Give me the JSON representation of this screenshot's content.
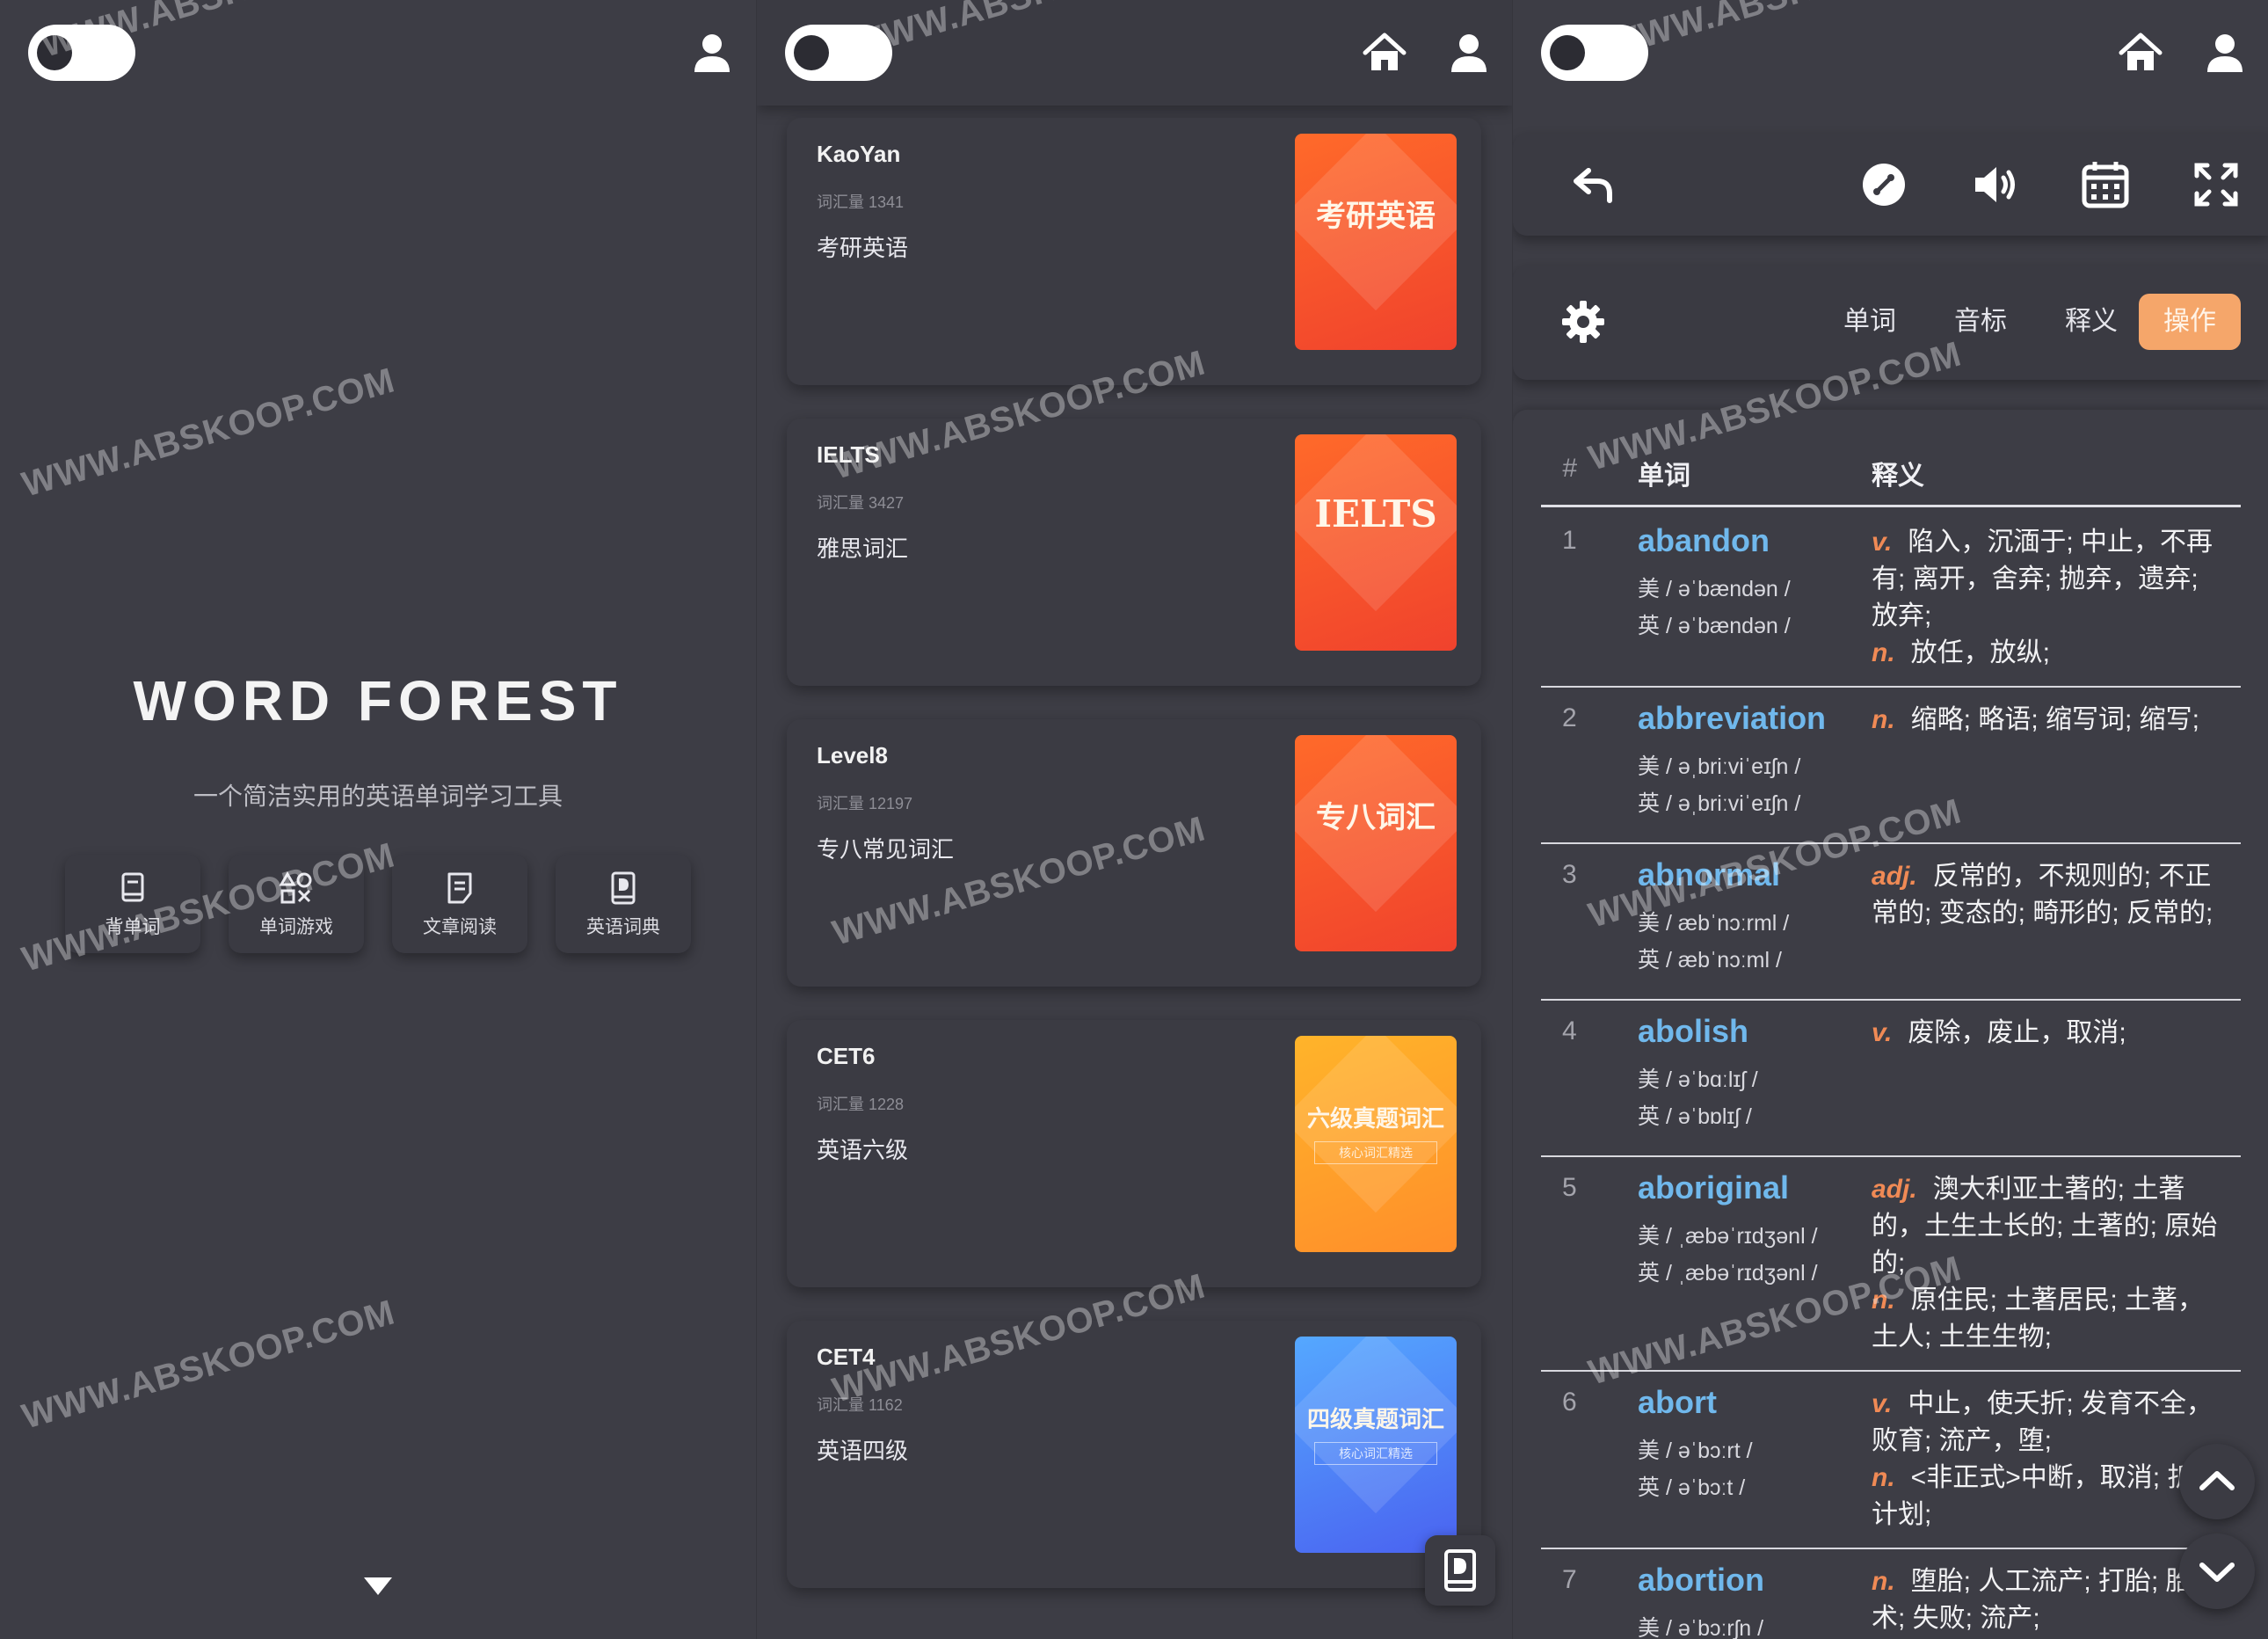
{
  "panel1": {
    "title": "WORD FOREST",
    "subtitle": "一个简洁实用的英语单词学习工具",
    "nav": [
      {
        "label": "背单词"
      },
      {
        "label": "单词游戏"
      },
      {
        "label": "文章阅读"
      },
      {
        "label": "英语词典"
      }
    ]
  },
  "panel2": {
    "books": [
      {
        "name": "KaoYan",
        "count": "词汇量 1341",
        "desc": "考研英语",
        "cover_title": "考研英语",
        "cover_sub": "",
        "cover_colors": [
          "#ff6a2a",
          "#f0422d"
        ]
      },
      {
        "name": "IELTS",
        "count": "词汇量 3427",
        "desc": "雅思词汇",
        "cover_title": "IELTS",
        "cover_sub": "",
        "cover_colors": [
          "#ff6a2a",
          "#f0422d"
        ]
      },
      {
        "name": "Level8",
        "count": "词汇量 12197",
        "desc": "专八常见词汇",
        "cover_title": "专八词汇",
        "cover_sub": "",
        "cover_colors": [
          "#ff6a2a",
          "#f0422d"
        ]
      },
      {
        "name": "CET6",
        "count": "词汇量 1228",
        "desc": "英语六级",
        "cover_title": "六级真题词汇",
        "cover_sub": "核心词汇精选",
        "cover_colors": [
          "#ffb42a",
          "#ff8e2a"
        ]
      },
      {
        "name": "CET4",
        "count": "词汇量 1162",
        "desc": "英语四级",
        "cover_title": "四级真题词汇",
        "cover_sub": "核心词汇精选",
        "cover_colors": [
          "#55a8ff",
          "#4a62f0"
        ]
      }
    ]
  },
  "panel3": {
    "tabs": [
      {
        "label": "单词",
        "active": false
      },
      {
        "label": "音标",
        "active": false
      },
      {
        "label": "释义",
        "active": false
      },
      {
        "label": "操作",
        "active": true
      }
    ],
    "table": {
      "headers": {
        "num": "#",
        "word": "单词",
        "def": "释义"
      },
      "rows": [
        {
          "num": "1",
          "word": "abandon",
          "us": "美 / əˈbændən /",
          "uk": "英 / əˈbændən /",
          "defs": [
            {
              "pos": "v.",
              "text": "陷入，沉湎于; 中止，不再有; 离开，舍弃; 抛弃，遗弃; 放弃;"
            },
            {
              "pos": "n.",
              "text": "放任，放纵;"
            }
          ]
        },
        {
          "num": "2",
          "word": "abbreviation",
          "us": "美 / əˌbriːviˈeɪʃn /",
          "uk": "英 / əˌbriːviˈeɪʃn /",
          "defs": [
            {
              "pos": "n.",
              "text": "缩略; 略语; 缩写词; 缩写;"
            }
          ]
        },
        {
          "num": "3",
          "word": "abnormal",
          "us": "美 / æbˈnɔːrml /",
          "uk": "英 / æbˈnɔːml /",
          "defs": [
            {
              "pos": "adj.",
              "text": "反常的，不规则的; 不正常的; 变态的; 畸形的; 反常的;"
            }
          ]
        },
        {
          "num": "4",
          "word": "abolish",
          "us": "美 / əˈbɑːlɪʃ /",
          "uk": "英 / əˈbɒlɪʃ /",
          "defs": [
            {
              "pos": "v.",
              "text": "废除，废止，取消;"
            }
          ]
        },
        {
          "num": "5",
          "word": "aboriginal",
          "us": "美 / ˌæbəˈrɪdʒənl /",
          "uk": "英 / ˌæbəˈrɪdʒənl /",
          "defs": [
            {
              "pos": "adj.",
              "text": "澳大利亚土著的; 土著的，土生土长的; 土著的; 原始的;"
            },
            {
              "pos": "n.",
              "text": "原住民; 土著居民; 土著，土人; 土生生物;"
            }
          ]
        },
        {
          "num": "6",
          "word": "abort",
          "us": "美 / əˈbɔːrt /",
          "uk": "英 / əˈbɔːt /",
          "defs": [
            {
              "pos": "v.",
              "text": "中止，使夭折; 发育不全，败育; 流产，堕;"
            },
            {
              "pos": "n.",
              "text": "<非正式>中断，取消; 折的计划;"
            }
          ]
        },
        {
          "num": "7",
          "word": "abortion",
          "us": "美 / əˈbɔːrʃn /",
          "uk": "",
          "defs": [
            {
              "pos": "n.",
              "text": "堕胎; 人工流产; 打胎; 胎手术; 失败; 流产;"
            }
          ]
        }
      ]
    }
  },
  "watermark": "WWW.ABSKOOP.COM",
  "colors": {
    "background": "#3d3d45",
    "accent_tab": "#f5a66a",
    "word_blue": "#70b8ec",
    "pos_orange": "#f08a55"
  },
  "icons": [
    "user-icon",
    "home-icon",
    "undo-icon",
    "music-link-icon",
    "speaker-icon",
    "calendar-icon",
    "fullscreen-icon",
    "gear-icon",
    "book-icon",
    "games-icon",
    "article-icon",
    "dictionary-icon",
    "chevron-up-icon",
    "chevron-down-icon"
  ]
}
